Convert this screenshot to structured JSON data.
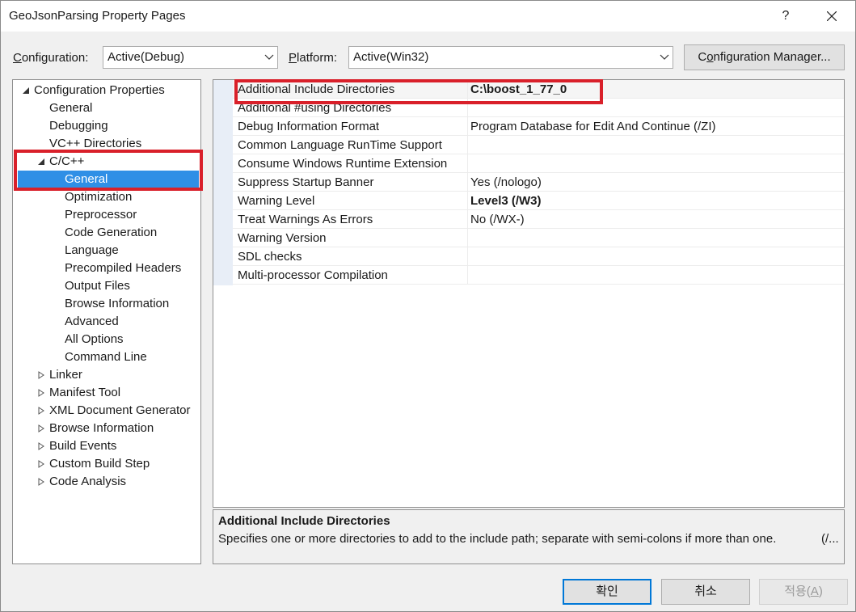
{
  "window": {
    "title": "GeoJsonParsing Property Pages",
    "help_label": "?"
  },
  "config": {
    "configuration_label_prefix": "C",
    "configuration_label_rest": "onfiguration:",
    "configuration_value": "Active(Debug)",
    "platform_label_prefix": "P",
    "platform_label_rest": "latform:",
    "platform_value": "Active(Win32)",
    "manager_prefix": "C",
    "manager_label_underlined": "o",
    "manager_label_rest": "nfiguration Manager..."
  },
  "tree": {
    "items": [
      {
        "label": "Configuration Properties",
        "expander": "expanded"
      },
      {
        "label": "General"
      },
      {
        "label": "Debugging"
      },
      {
        "label": "VC++ Directories"
      },
      {
        "label": "C/C++",
        "expander": "expanded"
      },
      {
        "label": "General",
        "selected": true
      },
      {
        "label": "Optimization"
      },
      {
        "label": "Preprocessor"
      },
      {
        "label": "Code Generation"
      },
      {
        "label": "Language"
      },
      {
        "label": "Precompiled Headers"
      },
      {
        "label": "Output Files"
      },
      {
        "label": "Browse Information"
      },
      {
        "label": "Advanced"
      },
      {
        "label": "All Options"
      },
      {
        "label": "Command Line"
      },
      {
        "label": "Linker",
        "expander": "collapsed"
      },
      {
        "label": "Manifest Tool",
        "expander": "collapsed"
      },
      {
        "label": "XML Document Generator",
        "expander": "collapsed"
      },
      {
        "label": "Browse Information",
        "expander": "collapsed"
      },
      {
        "label": "Build Events",
        "expander": "collapsed"
      },
      {
        "label": "Custom Build Step",
        "expander": "collapsed"
      },
      {
        "label": "Code Analysis",
        "expander": "collapsed"
      }
    ]
  },
  "grid": {
    "rows": [
      {
        "name": "Additional Include Directories",
        "value": "C:\\boost_1_77_0",
        "bold": true
      },
      {
        "name": "Additional #using Directories",
        "value": ""
      },
      {
        "name": "Debug Information Format",
        "value": "Program Database for Edit And Continue (/ZI)"
      },
      {
        "name": "Common Language RunTime Support",
        "value": ""
      },
      {
        "name": "Consume Windows Runtime Extension",
        "value": ""
      },
      {
        "name": "Suppress Startup Banner",
        "value": "Yes (/nologo)"
      },
      {
        "name": "Warning Level",
        "value": "Level3 (/W3)",
        "bold": true
      },
      {
        "name": "Treat Warnings As Errors",
        "value": "No (/WX-)"
      },
      {
        "name": "Warning Version",
        "value": ""
      },
      {
        "name": "SDL checks",
        "value": ""
      },
      {
        "name": "Multi-processor Compilation",
        "value": ""
      }
    ]
  },
  "description": {
    "title": "Additional Include Directories",
    "text": "Specifies one or more directories to add to the include path; separate with semi-colons if more than one.",
    "trunc": "(/..."
  },
  "buttons": {
    "ok": "확인",
    "cancel": "취소",
    "apply_prefix": "적용(",
    "apply_underlined": "A",
    "apply_suffix": ")"
  },
  "colors": {
    "highlight_box": "#d9202a",
    "selection": "#2f8fe6",
    "focus_border": "#0078d7"
  }
}
